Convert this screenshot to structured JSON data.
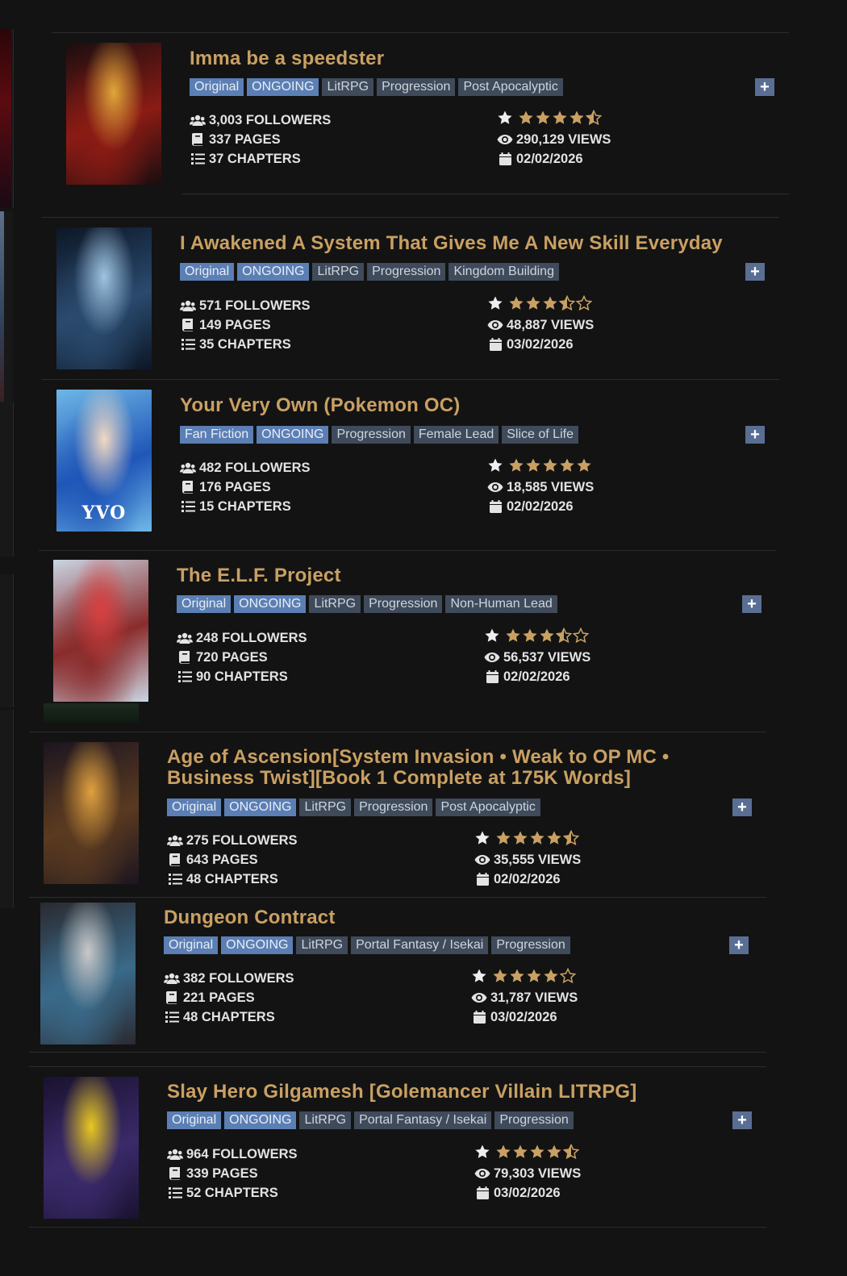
{
  "entries": [
    {
      "title": "Imma be a speedster",
      "tags": [
        {
          "label": "Original",
          "kind": "blue"
        },
        {
          "label": "ONGOING",
          "kind": "blue"
        },
        {
          "label": "LitRPG",
          "kind": "gray"
        },
        {
          "label": "Progression",
          "kind": "gray"
        },
        {
          "label": "Post Apocalyptic",
          "kind": "gray"
        }
      ],
      "followers": "3,003 FOLLOWERS",
      "pages": "337 PAGES",
      "chapters": "37 CHAPTERS",
      "rating": 4.5,
      "views": "290,129 VIEWS",
      "date": "02/02/2026",
      "cover_colors": [
        "#1a0e10",
        "#8b1b14",
        "#e0a63a"
      ]
    },
    {
      "title": "I Awakened A System That Gives Me A New Skill Everyday",
      "tags": [
        {
          "label": "Original",
          "kind": "blue"
        },
        {
          "label": "ONGOING",
          "kind": "blue"
        },
        {
          "label": "LitRPG",
          "kind": "gray"
        },
        {
          "label": "Progression",
          "kind": "gray"
        },
        {
          "label": "Kingdom Building",
          "kind": "gray"
        }
      ],
      "followers": "571 FOLLOWERS",
      "pages": "149 PAGES",
      "chapters": "35 CHAPTERS",
      "rating": 3.5,
      "views": "48,887 VIEWS",
      "date": "03/02/2026",
      "cover_colors": [
        "#0c1726",
        "#2a4a6e",
        "#9fc3e0"
      ]
    },
    {
      "title": "Your Very Own (Pokemon OC)",
      "tags": [
        {
          "label": "Fan Fiction",
          "kind": "blue"
        },
        {
          "label": "ONGOING",
          "kind": "blue"
        },
        {
          "label": "Progression",
          "kind": "gray"
        },
        {
          "label": "Female Lead",
          "kind": "gray"
        },
        {
          "label": "Slice of Life",
          "kind": "gray"
        }
      ],
      "followers": "482 FOLLOWERS",
      "pages": "176 PAGES",
      "chapters": "15 CHAPTERS",
      "rating": 5,
      "views": "18,585 VIEWS",
      "date": "02/02/2026",
      "cover_label": "YVO",
      "cover_colors": [
        "#6fb7e6",
        "#1f56b8",
        "#f1d9c4"
      ]
    },
    {
      "title": "The E.L.F. Project",
      "tags": [
        {
          "label": "Original",
          "kind": "blue"
        },
        {
          "label": "ONGOING",
          "kind": "blue"
        },
        {
          "label": "LitRPG",
          "kind": "gray"
        },
        {
          "label": "Progression",
          "kind": "gray"
        },
        {
          "label": "Non-Human Lead",
          "kind": "gray"
        }
      ],
      "followers": "248 FOLLOWERS",
      "pages": "720 PAGES",
      "chapters": "90 CHAPTERS",
      "rating": 3.5,
      "views": "56,537 VIEWS",
      "date": "02/02/2026",
      "cover_colors": [
        "#c9d6e4",
        "#8a2b2b",
        "#d84040"
      ]
    },
    {
      "title": "Age of Ascension[System Invasion • Weak to OP MC • Business Twist][Book 1 Complete at 175K Words]",
      "tags": [
        {
          "label": "Original",
          "kind": "blue"
        },
        {
          "label": "ONGOING",
          "kind": "blue"
        },
        {
          "label": "LitRPG",
          "kind": "gray"
        },
        {
          "label": "Progression",
          "kind": "gray"
        },
        {
          "label": "Post Apocalyptic",
          "kind": "gray"
        }
      ],
      "followers": "275 FOLLOWERS",
      "pages": "643 PAGES",
      "chapters": "48 CHAPTERS",
      "rating": 4.5,
      "views": "35,555 VIEWS",
      "date": "02/02/2026",
      "cover_colors": [
        "#1c1520",
        "#5a3a20",
        "#e0a040"
      ]
    },
    {
      "title": "Dungeon Contract",
      "tags": [
        {
          "label": "Original",
          "kind": "blue"
        },
        {
          "label": "ONGOING",
          "kind": "blue"
        },
        {
          "label": "LitRPG",
          "kind": "gray"
        },
        {
          "label": "Portal Fantasy / Isekai",
          "kind": "gray"
        },
        {
          "label": "Progression",
          "kind": "gray"
        }
      ],
      "followers": "382 FOLLOWERS",
      "pages": "221 PAGES",
      "chapters": "48 CHAPTERS",
      "rating": 4,
      "views": "31,787 VIEWS",
      "date": "03/02/2026",
      "cover_colors": [
        "#2a2a30",
        "#3a6a8a",
        "#c9c9c9"
      ]
    },
    {
      "title": "Slay Hero Gilgamesh [Golemancer Villain LITRPG]",
      "tags": [
        {
          "label": "Original",
          "kind": "blue"
        },
        {
          "label": "ONGOING",
          "kind": "blue"
        },
        {
          "label": "LitRPG",
          "kind": "gray"
        },
        {
          "label": "Portal Fantasy / Isekai",
          "kind": "gray"
        },
        {
          "label": "Progression",
          "kind": "gray"
        }
      ],
      "followers": "964 FOLLOWERS",
      "pages": "339 PAGES",
      "chapters": "52 CHAPTERS",
      "rating": 4.5,
      "views": "79,303 VIEWS",
      "date": "03/02/2026",
      "cover_colors": [
        "#1a1230",
        "#3a2a6a",
        "#e8c820"
      ]
    }
  ]
}
